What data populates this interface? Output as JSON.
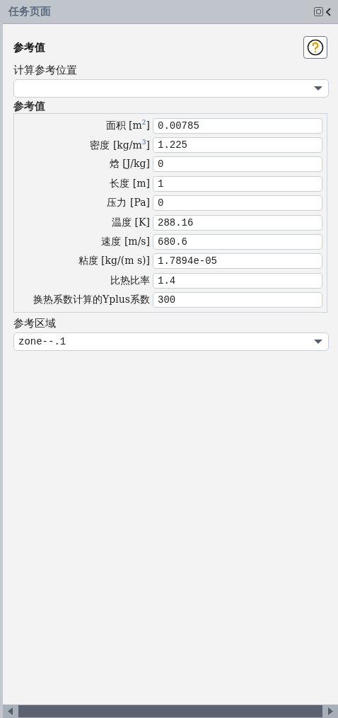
{
  "window": {
    "title": "任务页面"
  },
  "section_title": "参考值",
  "location": {
    "label": "计算参考位置"
  },
  "values_group": {
    "label": "参考值",
    "fields": [
      {
        "label": "面积 [m$^{2}$]",
        "value": "0.00785"
      },
      {
        "label": "密度 [kg/m$^{3}$]",
        "value": "1.225"
      },
      {
        "label": "焓 [J/kg]",
        "value": "0"
      },
      {
        "label": "长度 [m]",
        "value": "1"
      },
      {
        "label": "压力 [Pa]",
        "value": "0"
      },
      {
        "label": "温度 [K]",
        "value": "288.16"
      },
      {
        "label": "速度 [m/s]",
        "value": "680.6"
      },
      {
        "label": "粘度 [kg/(m s)]",
        "value": "1.7894e-05"
      },
      {
        "label": "比热比率",
        "value": "1.4"
      },
      {
        "label": "换热系数计算的Yplus系数",
        "value": "300"
      }
    ]
  },
  "zone": {
    "label": "参考区域",
    "value": "zone--.1"
  }
}
